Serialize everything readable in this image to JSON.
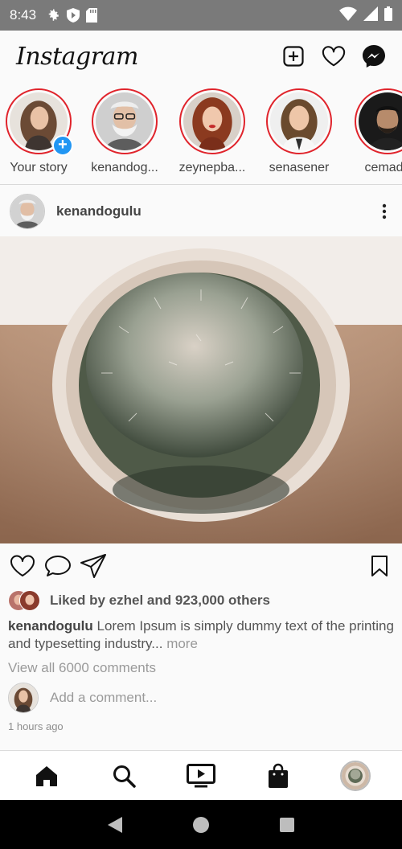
{
  "status_bar": {
    "time": "8:43",
    "icons": [
      "settings-icon",
      "shield-icon",
      "sd-card-icon",
      "wifi-icon",
      "signal-icon",
      "battery-icon"
    ]
  },
  "header": {
    "logo": "Instagram",
    "actions": [
      "new-post-icon",
      "heart-icon",
      "messenger-icon"
    ]
  },
  "stories": [
    {
      "name": "Your story",
      "is_own": true
    },
    {
      "name": "kenandog..."
    },
    {
      "name": "zeynepba..."
    },
    {
      "name": "senasener"
    },
    {
      "name": "cemadri"
    }
  ],
  "post": {
    "username": "kenandogulu",
    "likes_text": "Liked by ezhel and 923,000 others",
    "caption_user": "kenandogulu",
    "caption_text": " Lorem Ipsum is simply dummy text of the printing and typesetting industry...",
    "caption_more": " more",
    "view_comments": "View all 6000 comments",
    "comment_placeholder": "Add a comment...",
    "time_ago": "1 hours ago"
  },
  "bottom_nav": [
    "home-icon",
    "search-icon",
    "igtv-icon",
    "shop-icon",
    "profile-avatar"
  ],
  "colors": {
    "story_ring": "#e0242c",
    "add_story_badge": "#2196f3",
    "status_bar": "#7a7a7a"
  }
}
